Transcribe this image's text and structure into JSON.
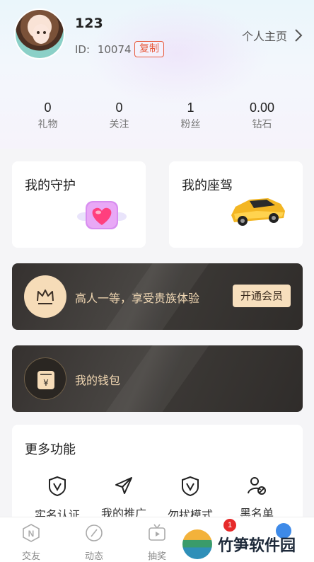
{
  "profile": {
    "username": "123",
    "id_label": "ID:",
    "id_value": "10074",
    "copy_label": "复制",
    "homepage_label": "个人主页"
  },
  "stats": [
    {
      "value": "0",
      "label": "礼物"
    },
    {
      "value": "0",
      "label": "关注"
    },
    {
      "value": "1",
      "label": "粉丝"
    },
    {
      "value": "0.00",
      "label": "钻石"
    }
  ],
  "cards": {
    "guard_title": "我的守护",
    "car_title": "我的座驾"
  },
  "vip": {
    "text": "高人一等，享受贵族体验",
    "button": "开通会员"
  },
  "wallet": {
    "text": "我的钱包"
  },
  "more": {
    "title": "更多功能",
    "items": [
      {
        "label": "实名认证",
        "icon": "shield-v-icon"
      },
      {
        "label": "我的推广",
        "icon": "paper-plane-icon"
      },
      {
        "label": "勿扰模式",
        "icon": "shield-v-icon"
      },
      {
        "label": "黑名单",
        "icon": "user-block-icon"
      }
    ]
  },
  "tabbar": {
    "items": [
      {
        "label": "交友",
        "icon": "n-badge-icon"
      },
      {
        "label": "动态",
        "icon": "compass-icon"
      },
      {
        "label": "抽奖",
        "icon": "tv-icon"
      }
    ],
    "badge_count": "1"
  },
  "watermark": {
    "text": "竹笋软件园"
  },
  "colors": {
    "accent_copy": "#e85a3c",
    "vip_gold": "#f1d7b2",
    "badge_red": "#e62a2a"
  }
}
